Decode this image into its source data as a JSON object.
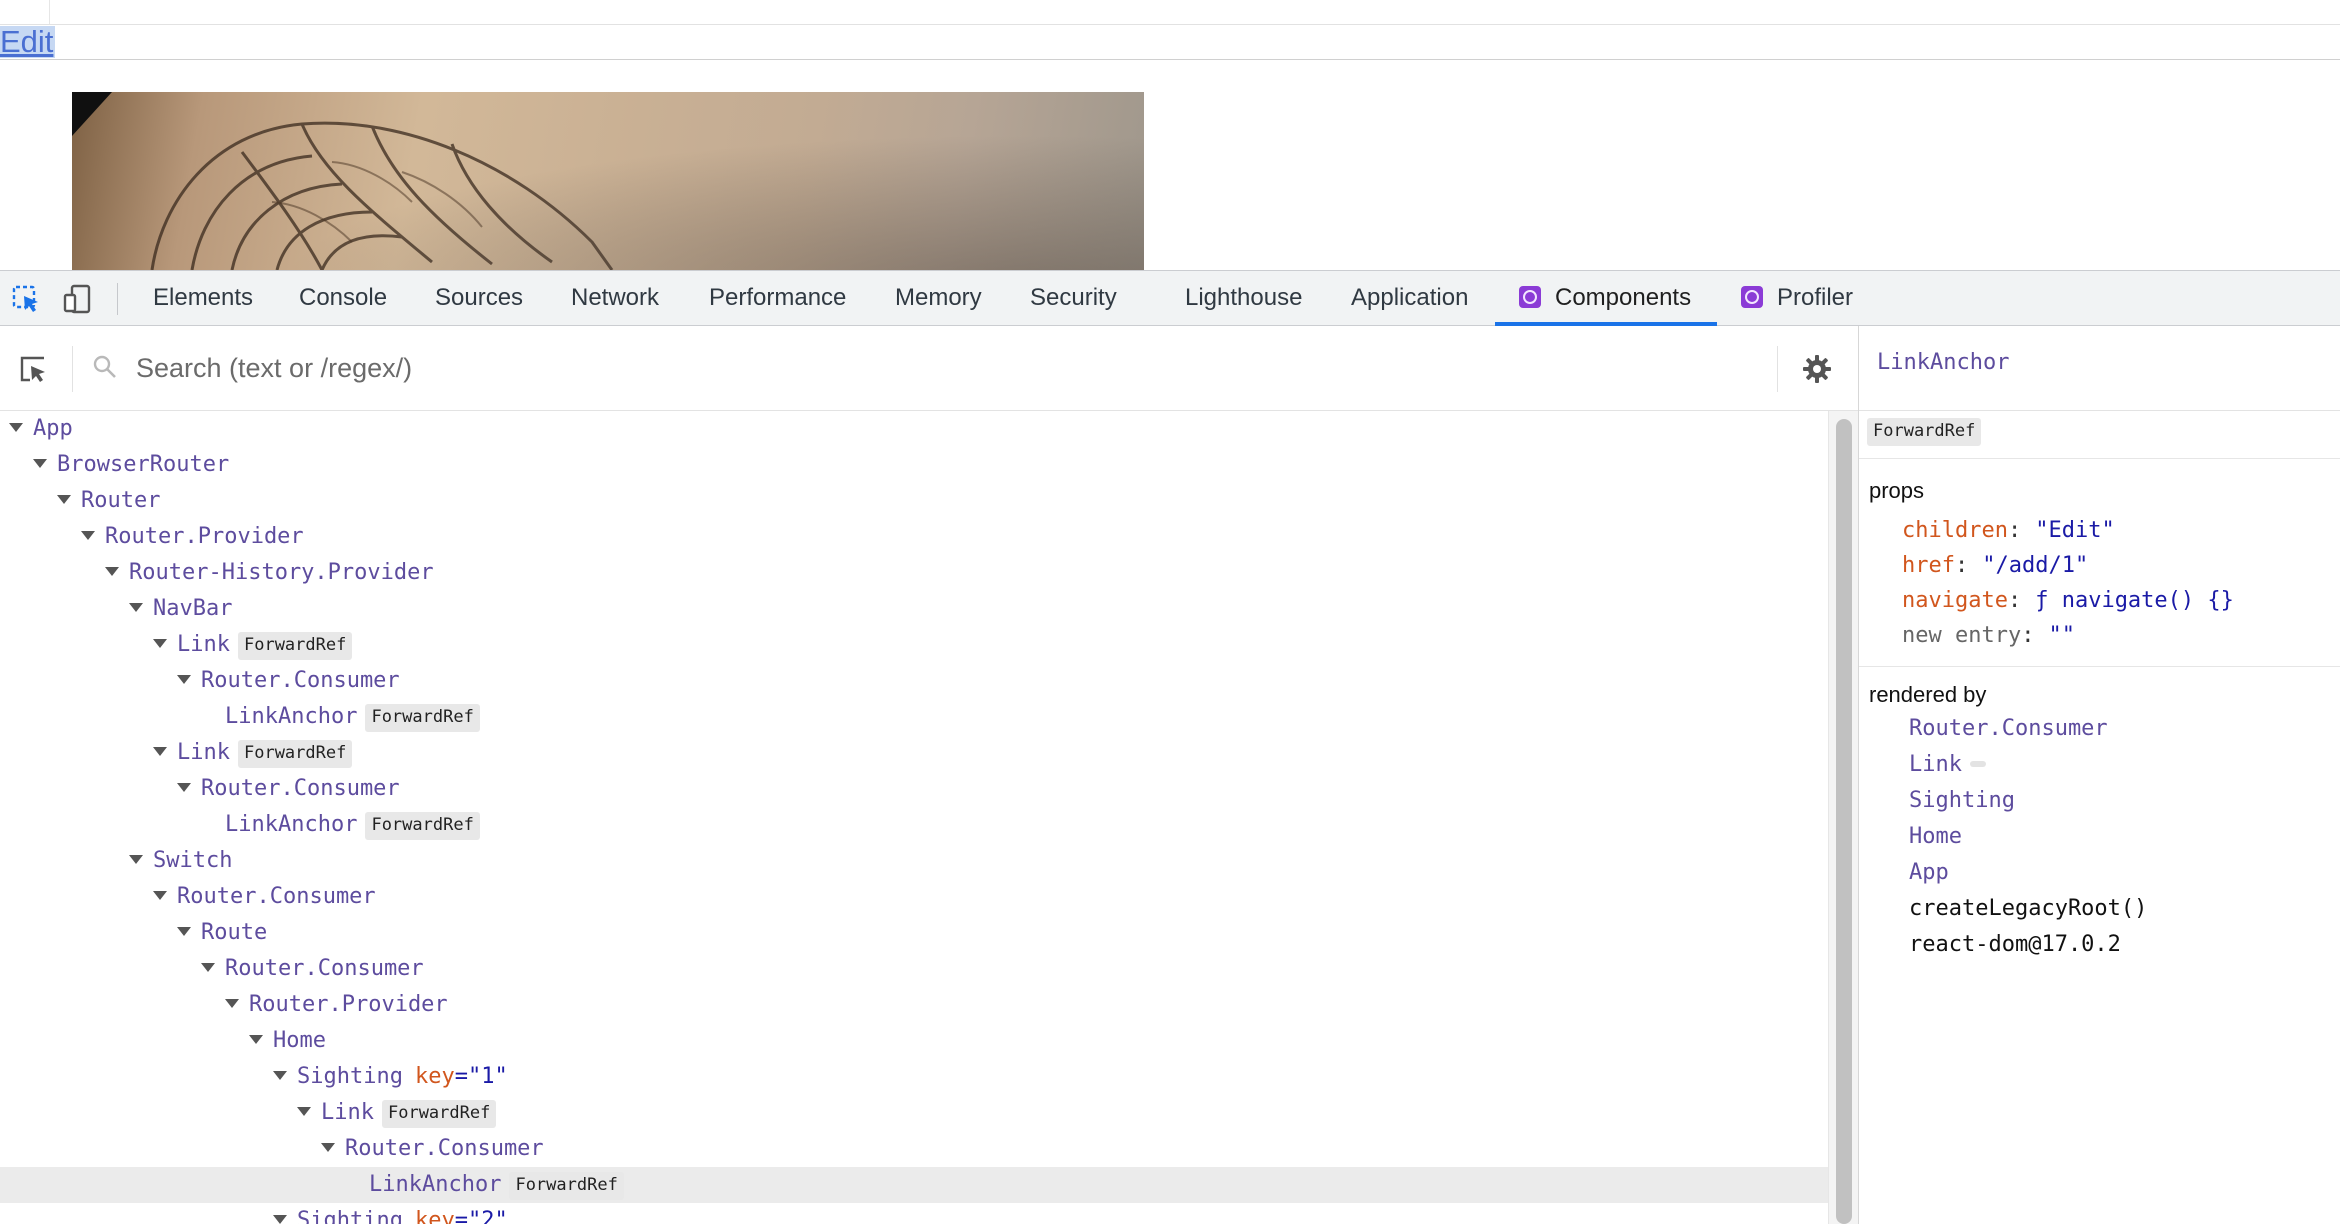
{
  "page": {
    "link_text": "Edit"
  },
  "devtools": {
    "tabs": [
      {
        "label": "Elements"
      },
      {
        "label": "Console"
      },
      {
        "label": "Sources"
      },
      {
        "label": "Network"
      },
      {
        "label": "Performance"
      },
      {
        "label": "Memory"
      },
      {
        "label": "Security"
      },
      {
        "label": "Lighthouse"
      },
      {
        "label": "Application"
      },
      {
        "label": "Components",
        "active": true
      },
      {
        "label": "Profiler"
      }
    ]
  },
  "search": {
    "placeholder": "Search (text or /regex/)"
  },
  "tree": [
    {
      "name": "App"
    },
    {
      "name": "BrowserRouter"
    },
    {
      "name": "Router"
    },
    {
      "name": "Router.Provider"
    },
    {
      "name": "Router-History.Provider"
    },
    {
      "name": "NavBar"
    },
    {
      "name": "Link",
      "badge": "ForwardRef"
    },
    {
      "name": "Router.Consumer"
    },
    {
      "name": "LinkAnchor",
      "badge": "ForwardRef"
    },
    {
      "name": "Link",
      "badge": "ForwardRef"
    },
    {
      "name": "Router.Consumer"
    },
    {
      "name": "LinkAnchor",
      "badge": "ForwardRef"
    },
    {
      "name": "Switch"
    },
    {
      "name": "Router.Consumer"
    },
    {
      "name": "Route"
    },
    {
      "name": "Router.Consumer"
    },
    {
      "name": "Router.Provider"
    },
    {
      "name": "Home"
    },
    {
      "name": "Sighting",
      "key_label": "key",
      "key_value": "=\"1\""
    },
    {
      "name": "Link",
      "badge": "ForwardRef"
    },
    {
      "name": "Router.Consumer"
    },
    {
      "name": "LinkAnchor",
      "badge": "ForwardRef",
      "selected": true
    },
    {
      "name": "Sighting",
      "key_label": "key",
      "key_value": "=\"2\""
    }
  ],
  "sidebar": {
    "title": "LinkAnchor",
    "badge": "ForwardRef",
    "props_heading": "props",
    "props": [
      {
        "name": "children",
        "value": "\"Edit\""
      },
      {
        "name": "href",
        "value": "\"/add/1\""
      },
      {
        "name": "navigate",
        "value": "ƒ navigate() {}"
      },
      {
        "name": "new entry",
        "value": "\"\"",
        "muted": true
      }
    ],
    "rendered_by_heading": "rendered by",
    "rendered_by": [
      {
        "name": "Router.Consumer"
      },
      {
        "name": "Link",
        "mini_badge": true
      },
      {
        "name": "Sighting"
      },
      {
        "name": "Home"
      },
      {
        "name": "App"
      },
      {
        "name": "createLegacyRoot()",
        "plain": true
      },
      {
        "name": "react-dom@17.0.2",
        "plain": true
      }
    ]
  }
}
